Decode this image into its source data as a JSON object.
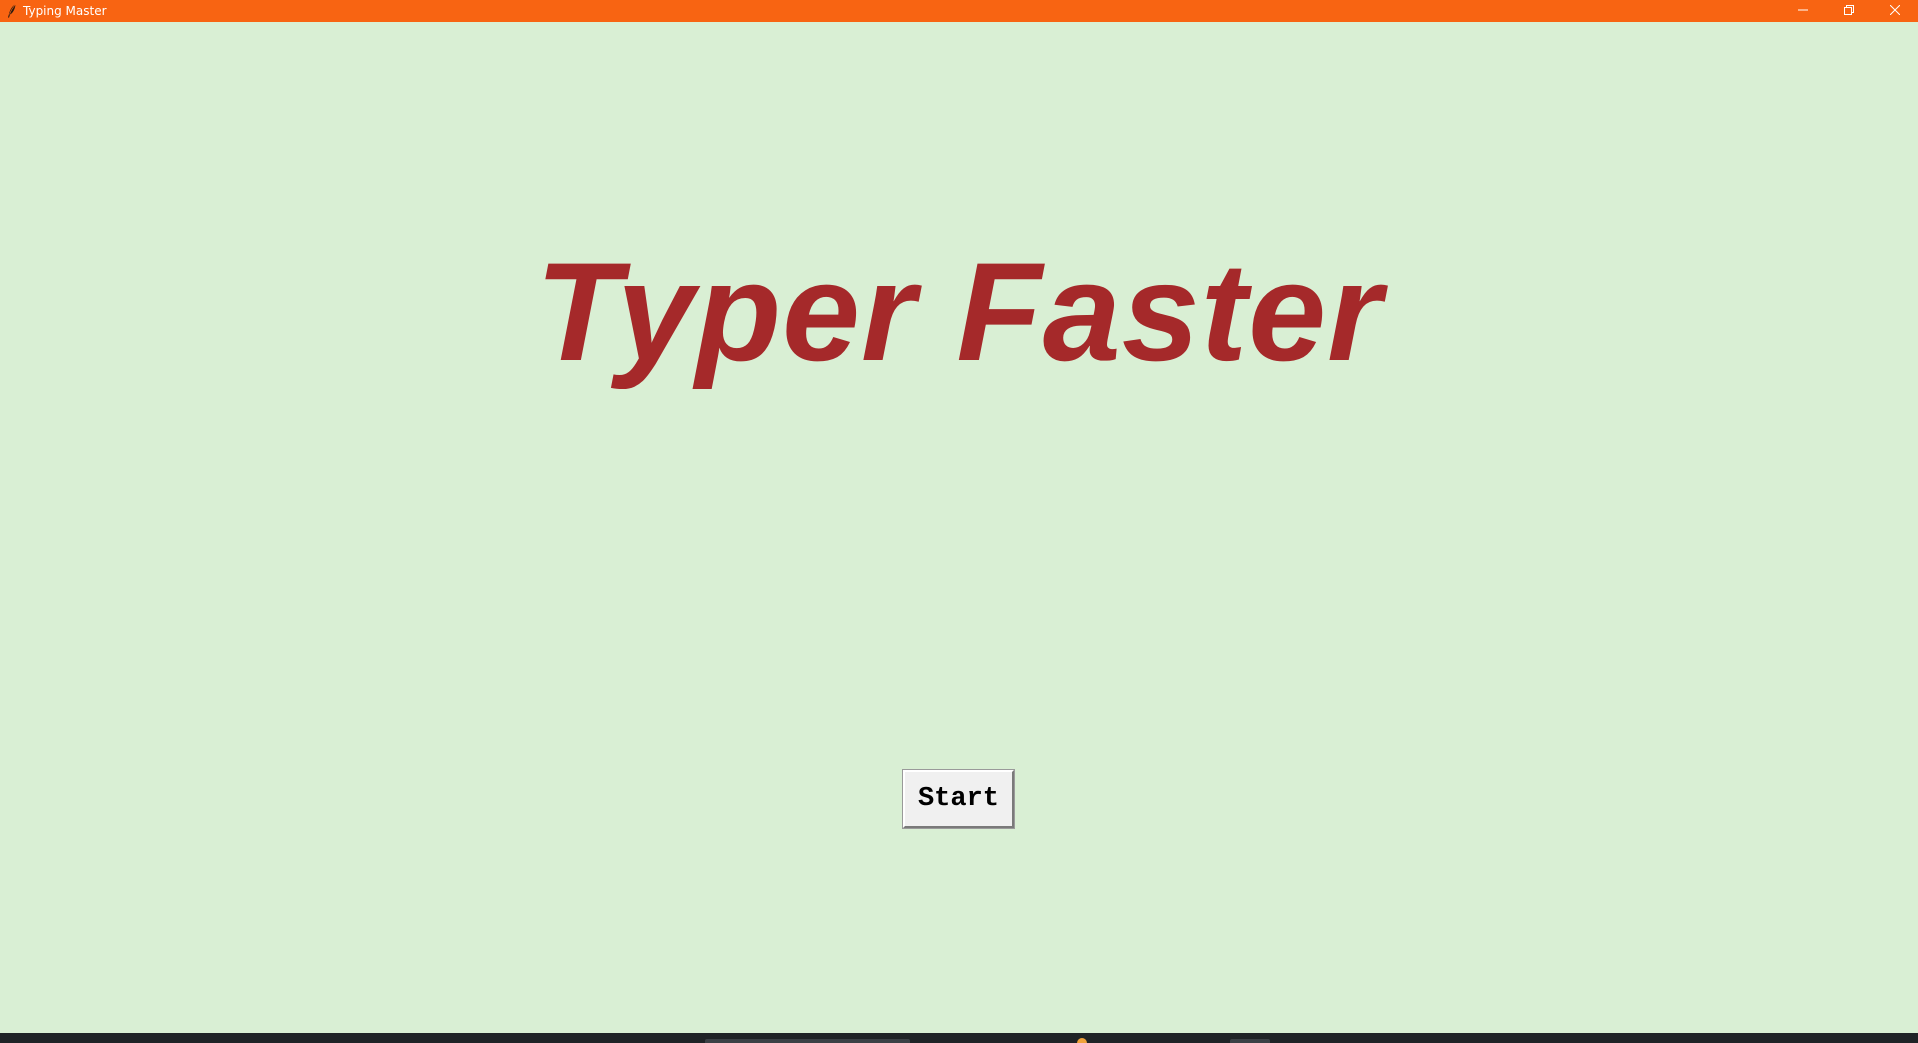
{
  "window": {
    "title": "Typing Master",
    "title_bar_color": "#f86412",
    "background_color": "#d9efd4",
    "icons": {
      "app": "feather-icon",
      "minimize": "minimize-icon",
      "maximize": "restore-icon",
      "close": "close-icon"
    }
  },
  "main": {
    "heading": "Typer Faster",
    "heading_color": "#a5292a",
    "start_button_label": "Start"
  }
}
